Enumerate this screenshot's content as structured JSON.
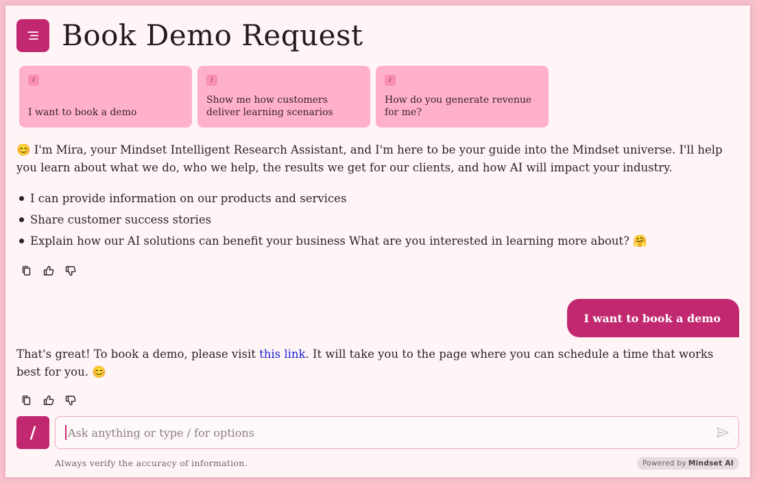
{
  "header": {
    "menu_icon": "menu-lines-icon",
    "title": "Book Demo Request"
  },
  "suggestions": [
    {
      "chip": "/",
      "text": "I want to book a demo"
    },
    {
      "chip": "/",
      "text": "Show me how customers deliver learning scenarios"
    },
    {
      "chip": "/",
      "text": "How do you generate revenue for me?"
    }
  ],
  "messages": {
    "assistant_intro": "😊 I'm Mira, your Mindset Intelligent Research Assistant, and I'm here to be your guide into the Mindset universe. I'll help you learn about what we do, who we help, the results we get for our clients, and how AI will impact your industry.",
    "assistant_bullets": [
      "I can provide information on our products and services",
      "Share customer success stories",
      "Explain how our AI solutions can benefit your business What are you interested in learning more about? 🤗"
    ],
    "user_message": "I want to book a demo",
    "assistant_reply_before_link": "That's great! To book a demo, please visit ",
    "assistant_reply_link": "this link",
    "assistant_reply_after_link": ". It will take you to the page where you can schedule a time that works best for you. 😊"
  },
  "actions": {
    "copy_icon": "copy-icon",
    "like_icon": "thumbs-up-icon",
    "dislike_icon": "thumbs-down-icon"
  },
  "composer": {
    "slash_label": "/",
    "placeholder": "Ask anything or type / for options",
    "value": "",
    "send_icon": "send-icon"
  },
  "footer": {
    "disclaimer": "Always verify the accuracy of information.",
    "powered_prefix": "Powered by",
    "powered_brand": "Mindset AI"
  },
  "colors": {
    "accent": "#c2286f",
    "suggestion_bg": "#ffb1c9",
    "page_bg": "#f7c0cc",
    "card_bg": "#fff5f6",
    "link": "#1a23d6"
  }
}
